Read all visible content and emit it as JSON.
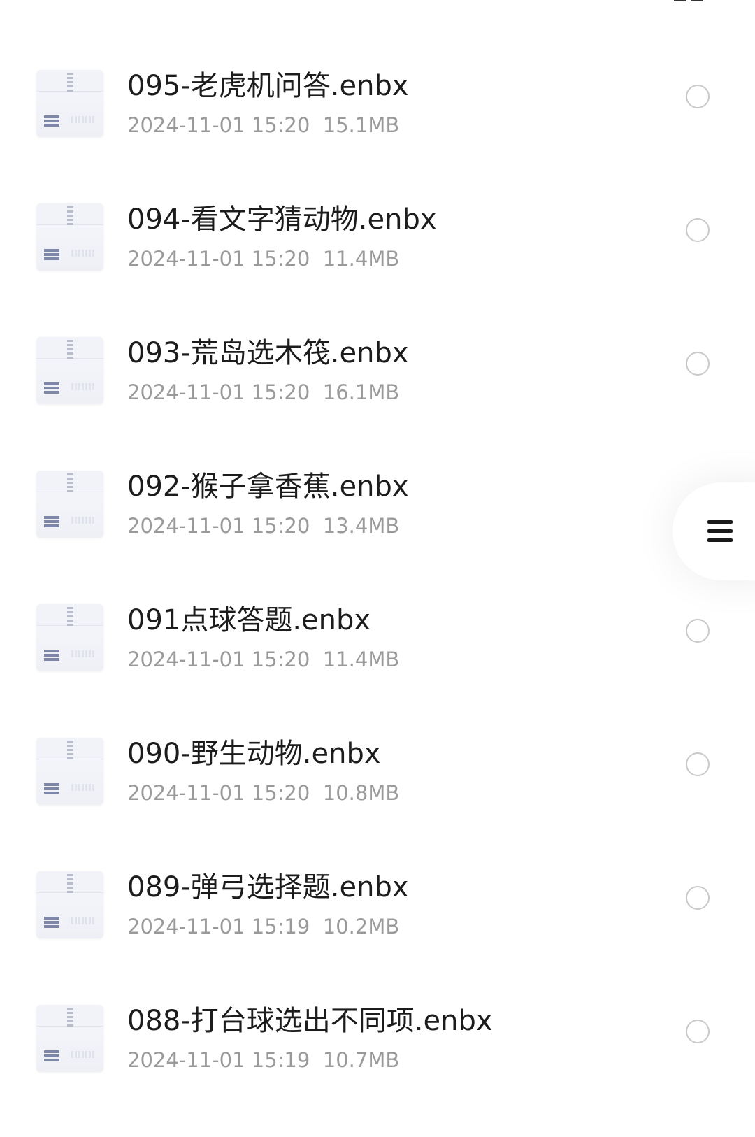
{
  "files": [
    {
      "name": "095-老虎机问答.enbx",
      "date": "2024-11-01 15:20",
      "size": "15.1MB"
    },
    {
      "name": "094-看文字猜动物.enbx",
      "date": "2024-11-01 15:20",
      "size": "11.4MB"
    },
    {
      "name": "093-荒岛选木筏.enbx",
      "date": "2024-11-01 15:20",
      "size": "16.1MB"
    },
    {
      "name": "092-猴子拿香蕉.enbx",
      "date": "2024-11-01 15:20",
      "size": "13.4MB"
    },
    {
      "name": "091点球答题.enbx",
      "date": "2024-11-01 15:20",
      "size": "11.4MB"
    },
    {
      "name": "090-野生动物.enbx",
      "date": "2024-11-01 15:20",
      "size": "10.8MB"
    },
    {
      "name": "089-弹弓选择题.enbx",
      "date": "2024-11-01 15:19",
      "size": "10.2MB"
    },
    {
      "name": "088-打台球选出不同项.enbx",
      "date": "2024-11-01 15:19",
      "size": "10.7MB"
    }
  ],
  "icons": {
    "file_thumb": "archive-file-icon",
    "select": "radio-circle-icon",
    "menu": "hamburger-menu-icon",
    "top_edge": "grid-view-icon"
  },
  "colors": {
    "name_text": "#1c1c1c",
    "meta_text": "#9a9a9a",
    "radio_border": "#c9c9c9",
    "background": "#ffffff"
  }
}
